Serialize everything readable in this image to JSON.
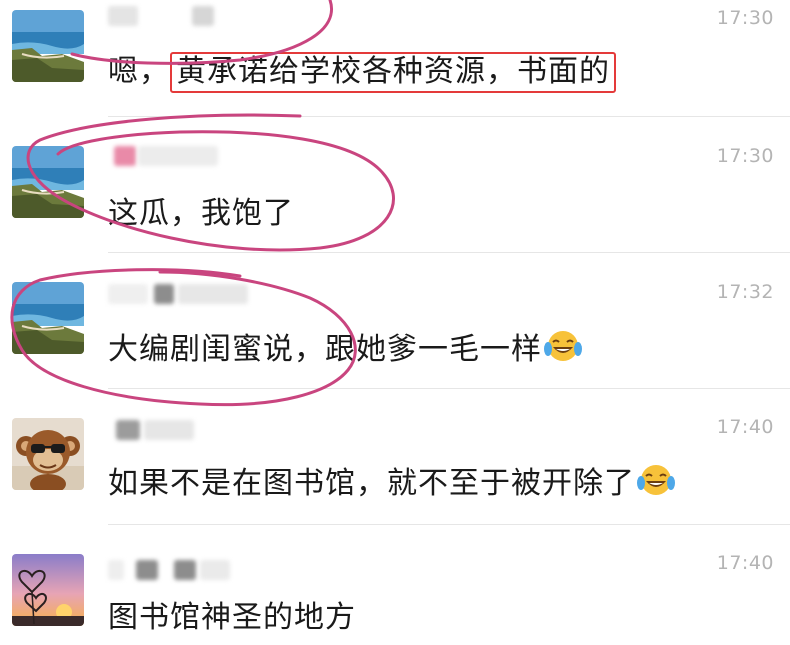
{
  "messages": [
    {
      "avatar": "ocean-cliff-avatar",
      "time": "17:30",
      "text_prefix": "嗯，",
      "text_highlight": "黄承诺给学校各种资源，书面的",
      "emoji": ""
    },
    {
      "avatar": "ocean-cliff-avatar",
      "time": "17:30",
      "text": "这瓜，我饱了",
      "emoji": ""
    },
    {
      "avatar": "ocean-cliff-avatar",
      "time": "17:32",
      "text": "大编剧闺蜜说，跟她爹一毛一样",
      "emoji": "tears-of-joy-emoji"
    },
    {
      "avatar": "monkey-toy-avatar",
      "time": "17:40",
      "text": "如果不是在图书馆，就不至于被开除了",
      "emoji": "tears-of-joy-emoji"
    },
    {
      "avatar": "heart-sunset-avatar",
      "time": "17:40",
      "text": "图书馆神圣的地方",
      "emoji": ""
    }
  ],
  "colors": {
    "highlight_box": "#e43a3a",
    "annotation_stroke": "#c9457f",
    "timestamp": "#b4b4b4",
    "message_text": "#1a1a1a"
  }
}
